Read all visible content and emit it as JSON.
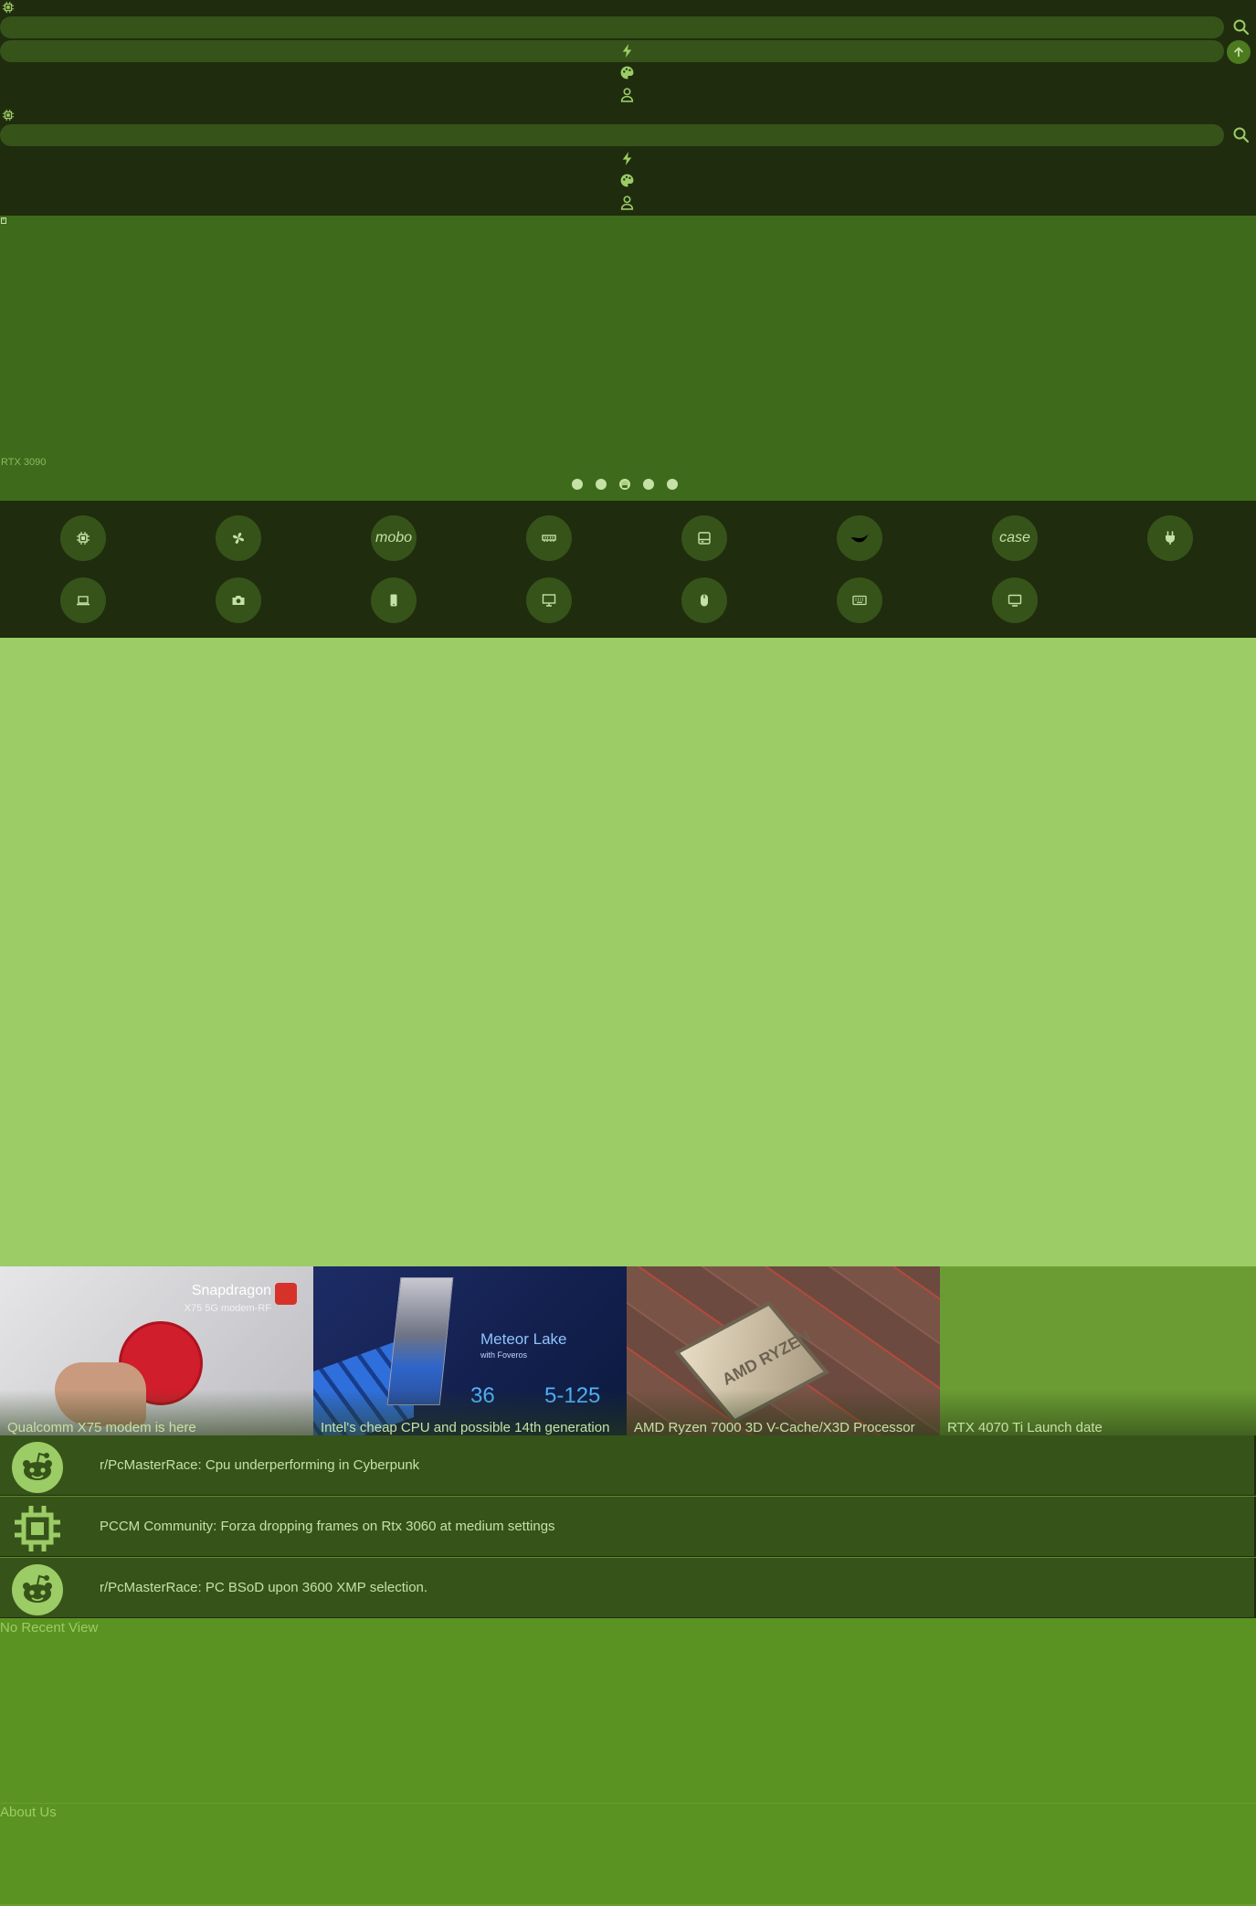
{
  "header": {
    "search_placeholder": "",
    "nav_icons": [
      "bolt-icon",
      "palette-icon",
      "user-icon"
    ]
  },
  "hero": {
    "caption": "RTX 3090",
    "slide_count": 5,
    "active_slide": 3
  },
  "categories": {
    "row1": [
      {
        "name": "cpu",
        "icon": "chip-icon",
        "label": ""
      },
      {
        "name": "cooler",
        "icon": "fan-icon",
        "label": ""
      },
      {
        "name": "motherboard",
        "icon": "",
        "label": "mobo"
      },
      {
        "name": "memory",
        "icon": "ram-icon",
        "label": ""
      },
      {
        "name": "storage",
        "icon": "drive-icon",
        "label": ""
      },
      {
        "name": "gpu",
        "icon": "gpu-icon",
        "label": ""
      },
      {
        "name": "case",
        "icon": "",
        "label": "case"
      },
      {
        "name": "psu",
        "icon": "plug-icon",
        "label": ""
      }
    ],
    "row2": [
      {
        "name": "laptop",
        "icon": "laptop-icon"
      },
      {
        "name": "camera",
        "icon": "camera-icon"
      },
      {
        "name": "phone",
        "icon": "phone-icon"
      },
      {
        "name": "desktop",
        "icon": "desktop-icon"
      },
      {
        "name": "mouse",
        "icon": "mouse-icon"
      },
      {
        "name": "keyboard",
        "icon": "keyboard-icon"
      },
      {
        "name": "monitor",
        "icon": "monitor-icon"
      }
    ]
  },
  "news": [
    {
      "title": "Qualcomm X75 modem is here",
      "image_text": "Snapdragon",
      "image_subtext": "X75 5G modem-RF"
    },
    {
      "title": "Intel's cheap CPU and possible 14th generation",
      "image_text": "Meteor Lake",
      "image_subtext": "with Foveros",
      "stat1": "36",
      "stat2": "5-125"
    },
    {
      "title": "AMD Ryzen 7000 3D V-Cache/X3D Processor",
      "image_text": "AMD RYZEN"
    },
    {
      "title": "RTX 4070 Ti Launch date"
    }
  ],
  "forum_posts": [
    {
      "icon": "reddit-icon",
      "text": "r/PcMasterRace: Cpu underperforming in Cyberpunk"
    },
    {
      "icon": "chip-icon",
      "text": "PCCM Community: Forza dropping frames on Rtx 3060 at medium settings"
    },
    {
      "icon": "reddit-icon",
      "text": "r/PcMasterRace: PC BSoD upon 3600 XMP selection."
    }
  ],
  "recent": {
    "empty_text": "No Recent View"
  },
  "footer": {
    "about_label": "About Us"
  },
  "colors": {
    "dark": "#1f2c0e",
    "mid": "#36531a",
    "hero": "#3e6b1b",
    "light": "#9ccc65",
    "page": "#5a9322"
  }
}
